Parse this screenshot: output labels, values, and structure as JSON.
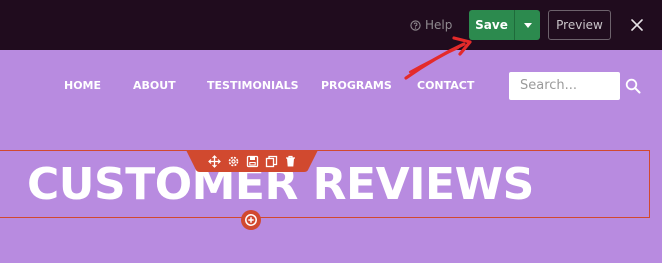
{
  "editor_bar": {
    "help_label": "Help",
    "save_label": "Save",
    "preview_label": "Preview",
    "icons": [
      "help-icon",
      "chevron-down-icon",
      "close-icon"
    ],
    "colors": {
      "bar_background": "#200c1e",
      "save_green": "#2c8a4e"
    }
  },
  "nav": {
    "items": [
      "HOME",
      "ABOUT",
      "TESTIMONIALS",
      "PROGRAMS",
      "CONTACT"
    ]
  },
  "search": {
    "placeholder": "Search...",
    "icon": "search-icon"
  },
  "module": {
    "heading": "CUSTOMER REVIEWS",
    "toolbar_icons": [
      "move-icon",
      "settings-icon",
      "save-module-icon",
      "duplicate-icon",
      "delete-icon"
    ],
    "add_icon": "add-circle-icon",
    "colors": {
      "accent": "#d1492f",
      "page_background": "#b88be0"
    }
  }
}
